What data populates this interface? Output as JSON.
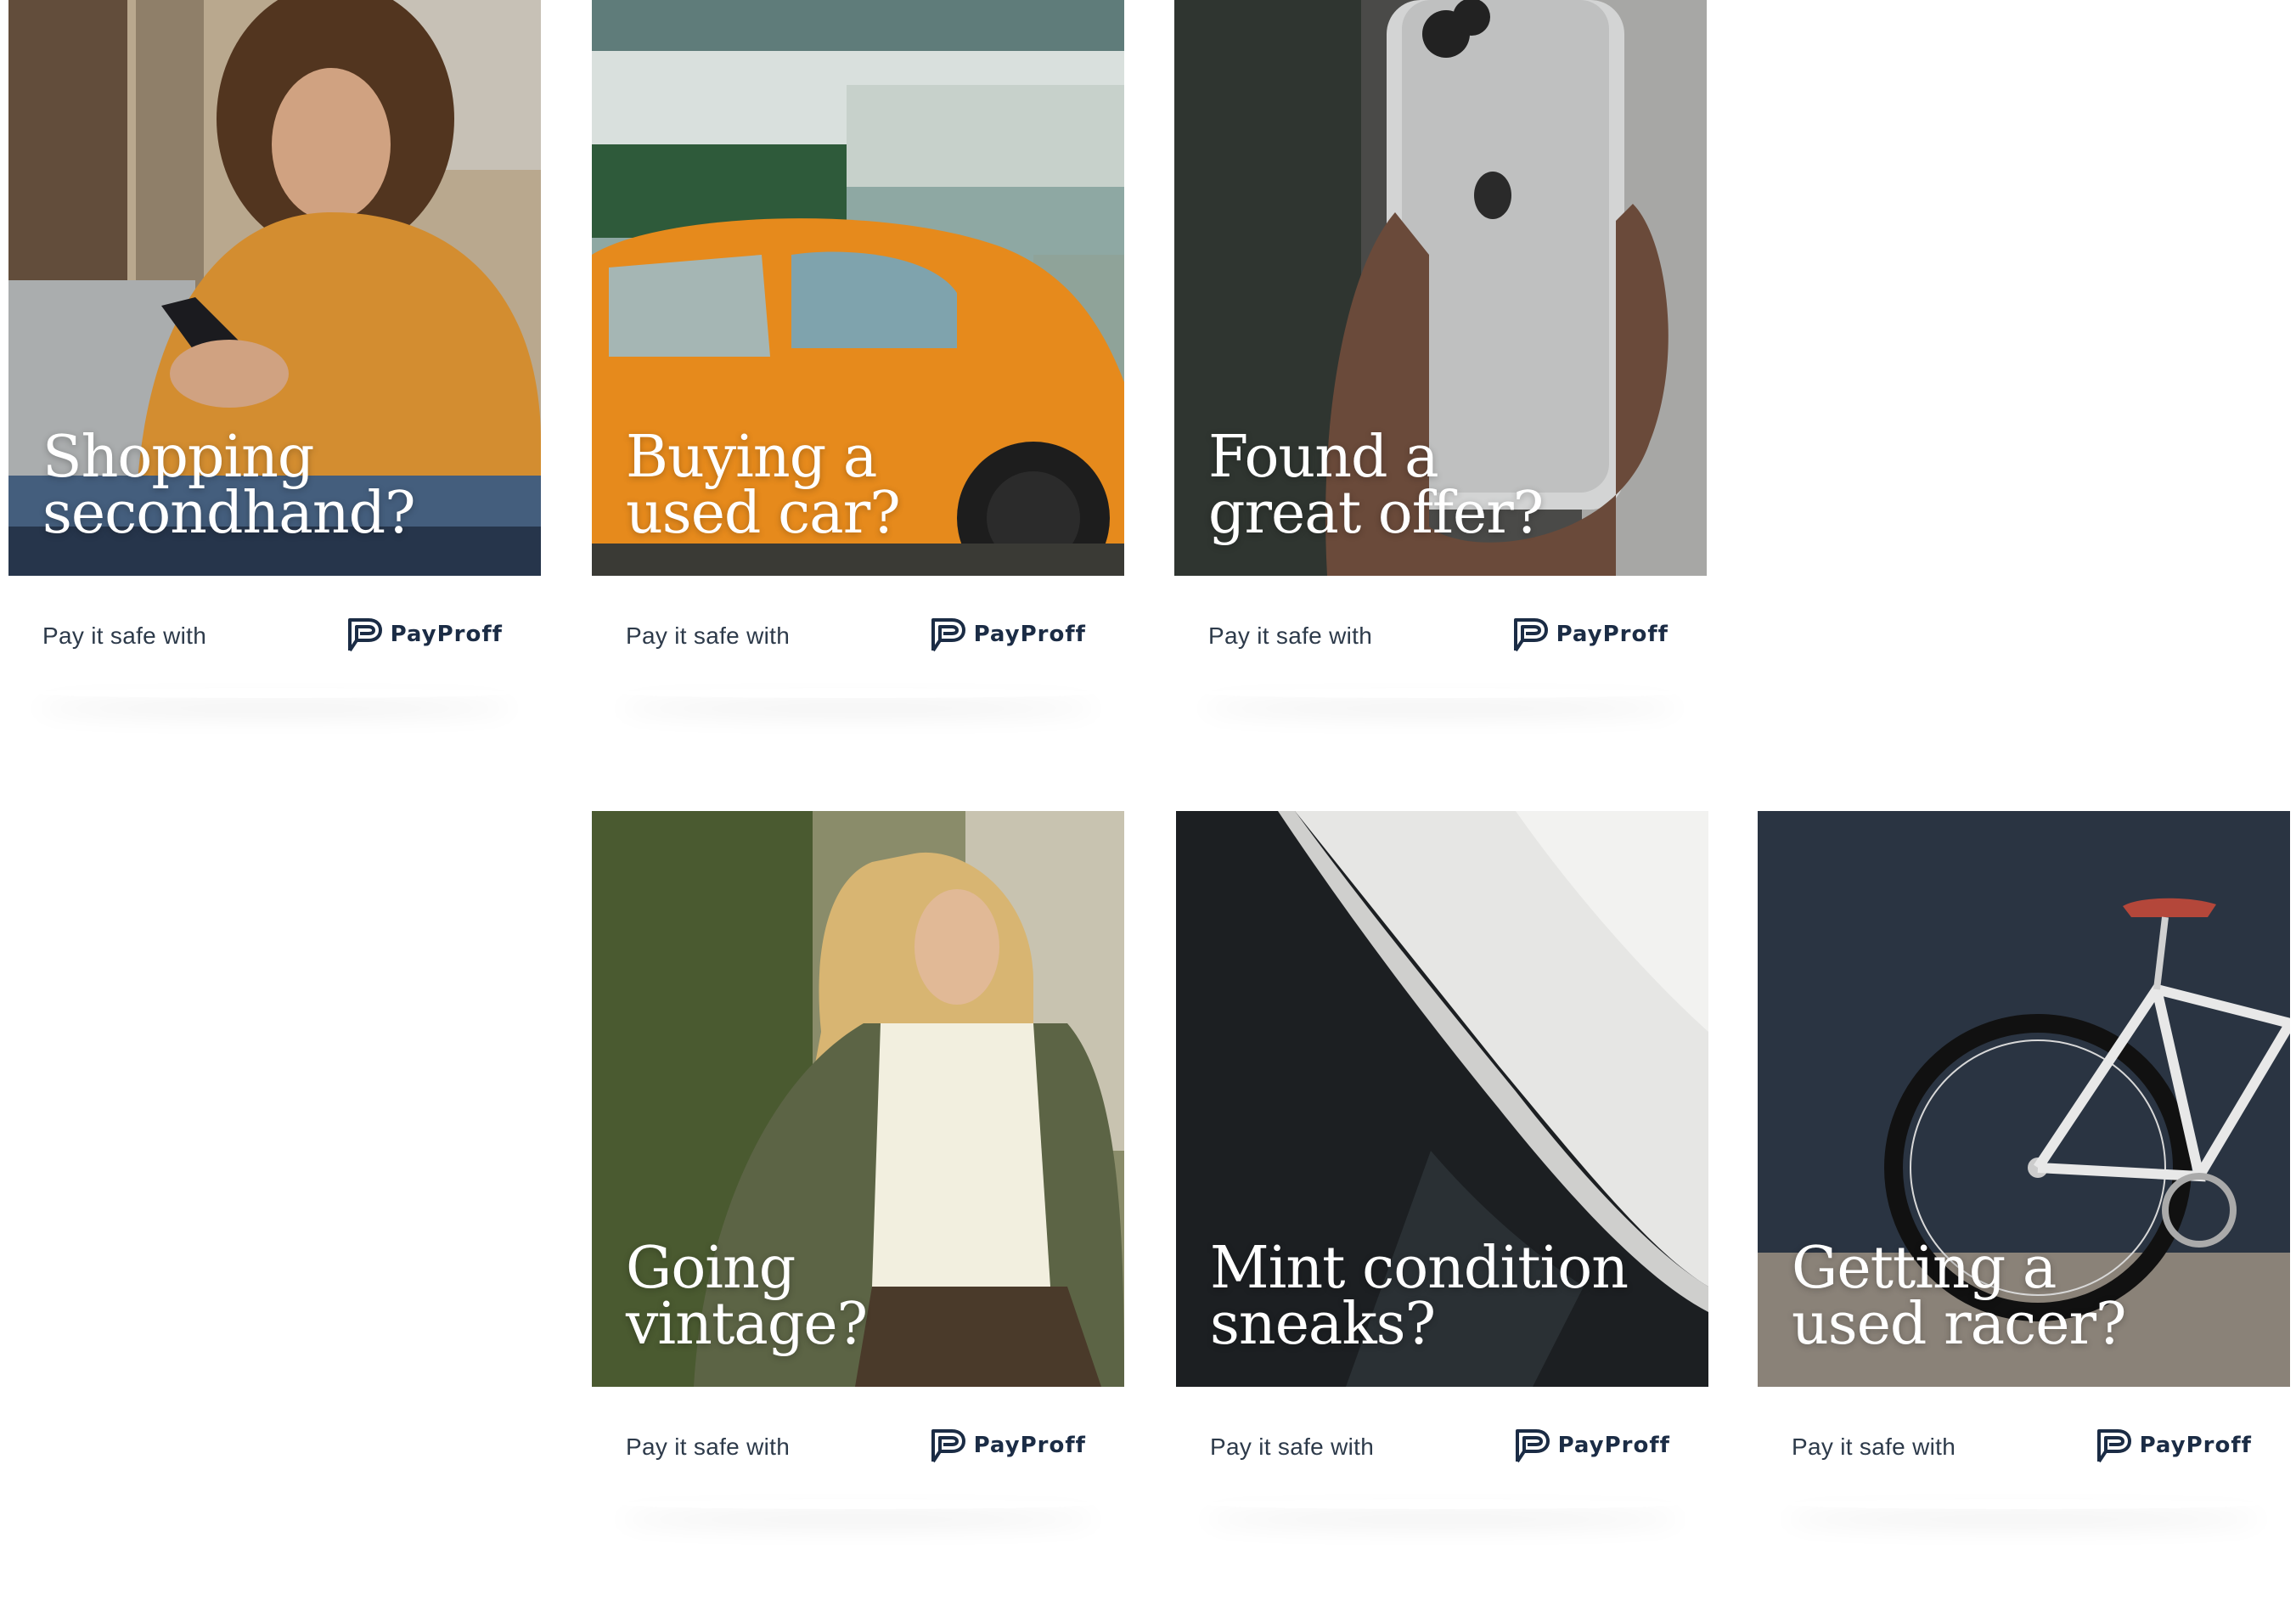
{
  "cards": [
    {
      "headline": [
        "Shopping",
        "secondhand?"
      ],
      "tagline": "Pay it safe with",
      "brand": "PayProff",
      "photo": "woman-with-phone-in-hoodie"
    },
    {
      "headline": [
        "Buying a",
        "used car?"
      ],
      "tagline": "Pay it safe with",
      "brand": "PayProff",
      "photo": "orange-beetle-car"
    },
    {
      "headline": [
        "Found a",
        "great offer?"
      ],
      "tagline": "Pay it safe with",
      "brand": "PayProff",
      "photo": "hand-holding-iphone"
    },
    {
      "headline": [
        "Going",
        "vintage?"
      ],
      "tagline": "Pay it safe with",
      "brand": "PayProff",
      "photo": "woman-in-vintage-blazer"
    },
    {
      "headline": [
        "Mint condition",
        "sneaks?"
      ],
      "tagline": "Pay it safe with",
      "brand": "PayProff",
      "photo": "white-sneaker"
    },
    {
      "headline": [
        "Getting a",
        "used racer?"
      ],
      "tagline": "Pay it safe with",
      "brand": "PayProff",
      "photo": "white-road-bike"
    }
  ],
  "colors": {
    "text_dark": "#2d3a4a",
    "brand_navy": "#1b2c45",
    "headline": "#ffffff"
  }
}
